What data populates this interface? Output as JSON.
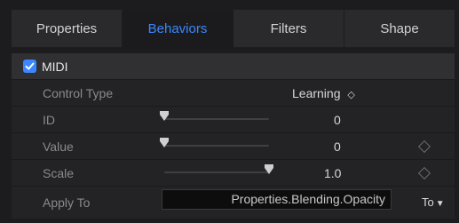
{
  "tabs": [
    {
      "label": "Properties",
      "active": false
    },
    {
      "label": "Behaviors",
      "active": true
    },
    {
      "label": "Filters",
      "active": false
    },
    {
      "label": "Shape",
      "active": false
    }
  ],
  "midi": {
    "title": "MIDI",
    "enabled": true
  },
  "rows": {
    "control_type": {
      "label": "Control Type",
      "value": "Learning",
      "arrows": "◇"
    },
    "id": {
      "label": "ID",
      "value": "0",
      "slider_fraction": 0.0
    },
    "value": {
      "label": "Value",
      "value": "0",
      "slider_fraction": 0.0
    },
    "scale": {
      "label": "Scale",
      "value": "1.0",
      "slider_fraction": 1.0
    },
    "apply_to": {
      "label": "Apply To",
      "value": "Properties.Blending.Opacity",
      "menu_label": "To"
    }
  },
  "colors": {
    "accent": "#3b87ff",
    "background": "#1c1c1e",
    "panel": "#232325"
  },
  "icons": {
    "checkbox": "checkmark-icon",
    "keyframe": "diamond-icon",
    "menu": "chevron-down-icon"
  }
}
